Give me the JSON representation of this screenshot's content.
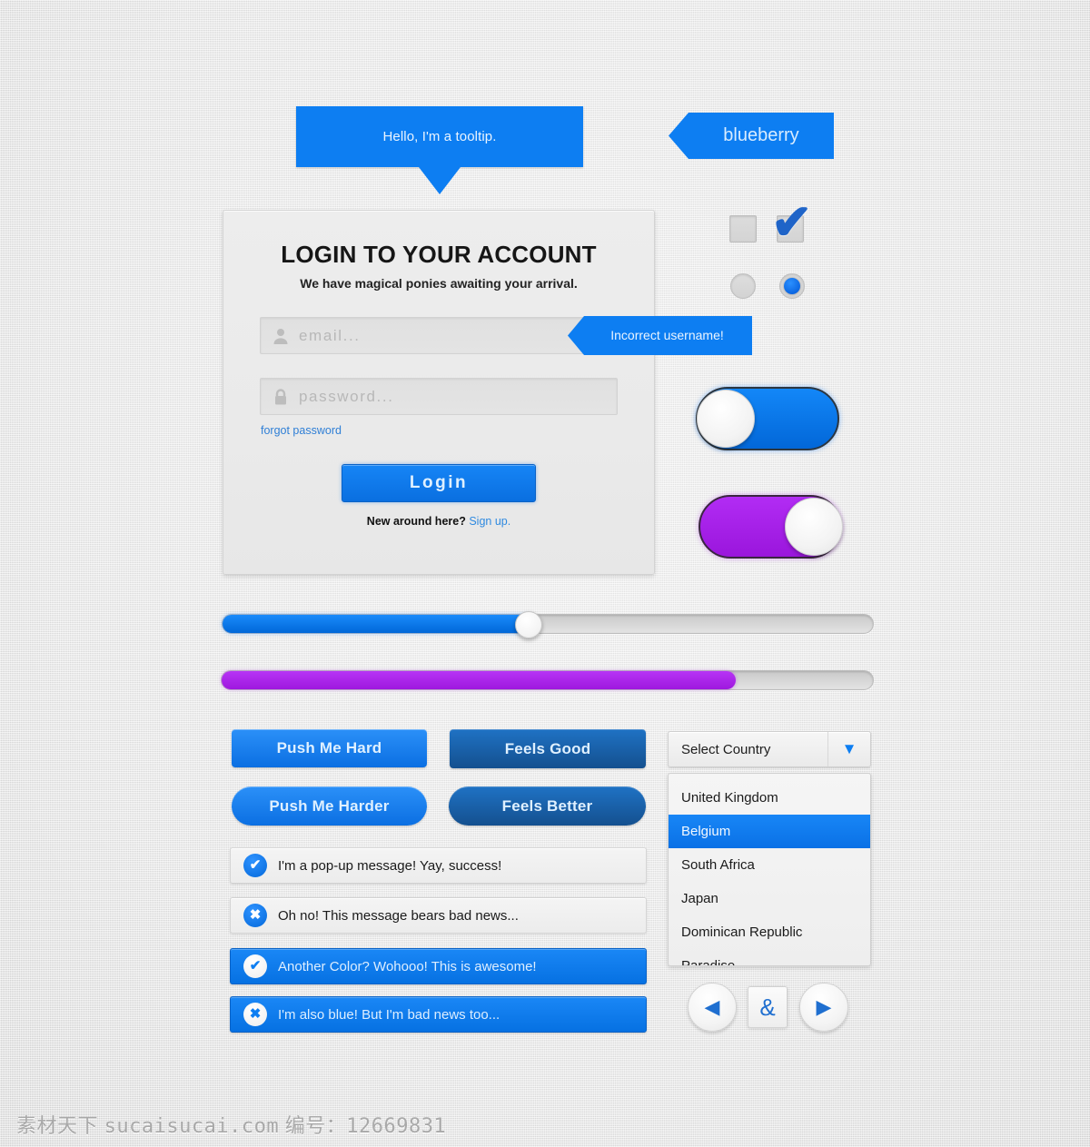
{
  "tooltip": {
    "text": "Hello, I'm a tooltip."
  },
  "tag": {
    "label": "blueberry"
  },
  "login": {
    "title": "LOGIN TO YOUR ACCOUNT",
    "subtitle": "We have magical ponies awaiting your arrival.",
    "email_placeholder": "email...",
    "email_icon": "user-icon",
    "password_placeholder": "password...",
    "password_icon": "lock-icon",
    "error_tooltip": "Incorrect username!",
    "forgot_label": "forgot password",
    "submit_label": "Login",
    "signup_prefix": "New around here? ",
    "signup_link": "Sign up."
  },
  "controls": {
    "checkbox_unchecked_state": "unchecked",
    "checkbox_checked_state": "checked",
    "check_glyph": "✔",
    "radio_unselected_state": "unselected",
    "radio_selected_state": "selected",
    "toggle_blue_state": "off",
    "toggle_purple_state": "on"
  },
  "slider": {
    "value_percent": 47,
    "fill_color": "#0d7ef2"
  },
  "progress": {
    "value_percent": 79,
    "fill_color": "#a826ee"
  },
  "buttons": [
    {
      "label": "Push Me Hard",
      "style": "blue-rect"
    },
    {
      "label": "Feels Good",
      "style": "dark-rect"
    },
    {
      "label": "Push Me Harder",
      "style": "blue-pill"
    },
    {
      "label": "Feels Better",
      "style": "dark-pill"
    }
  ],
  "alerts": [
    {
      "text": "I'm a pop-up message! Yay, success!",
      "icon": "check-icon",
      "variant": "light-success"
    },
    {
      "text": "Oh no! This message bears bad news...",
      "icon": "cross-icon",
      "variant": "light-error"
    },
    {
      "text": "Another Color? Wohooo! This is awesome!",
      "icon": "check-icon",
      "variant": "blue-success"
    },
    {
      "text": "I'm also blue! But I'm bad news too...",
      "icon": "cross-icon",
      "variant": "blue-error"
    }
  ],
  "alert_glyphs": {
    "check": "✔",
    "cross": "✖"
  },
  "select": {
    "label": "Select Country",
    "caret_icon": "chevron-down-icon",
    "caret_glyph": "▼",
    "options": [
      "United Kingdom",
      "Belgium",
      "South Africa",
      "Japan",
      "Dominican Republic",
      "Paradise"
    ],
    "selected": "Belgium"
  },
  "pager": {
    "prev_icon": "triangle-left-icon",
    "prev_glyph": "◀",
    "middle_label": "&",
    "next_icon": "triangle-right-icon",
    "next_glyph": "▶"
  },
  "watermark": {
    "brand": "素材天下",
    "site": "sucaisucai.com",
    "id_label": "编号：",
    "id_value": "12669831"
  },
  "colors": {
    "accent_blue": "#0d7ef2",
    "dark_blue": "#1560b0",
    "purple": "#a826ee",
    "background": "#e5e5e5"
  }
}
